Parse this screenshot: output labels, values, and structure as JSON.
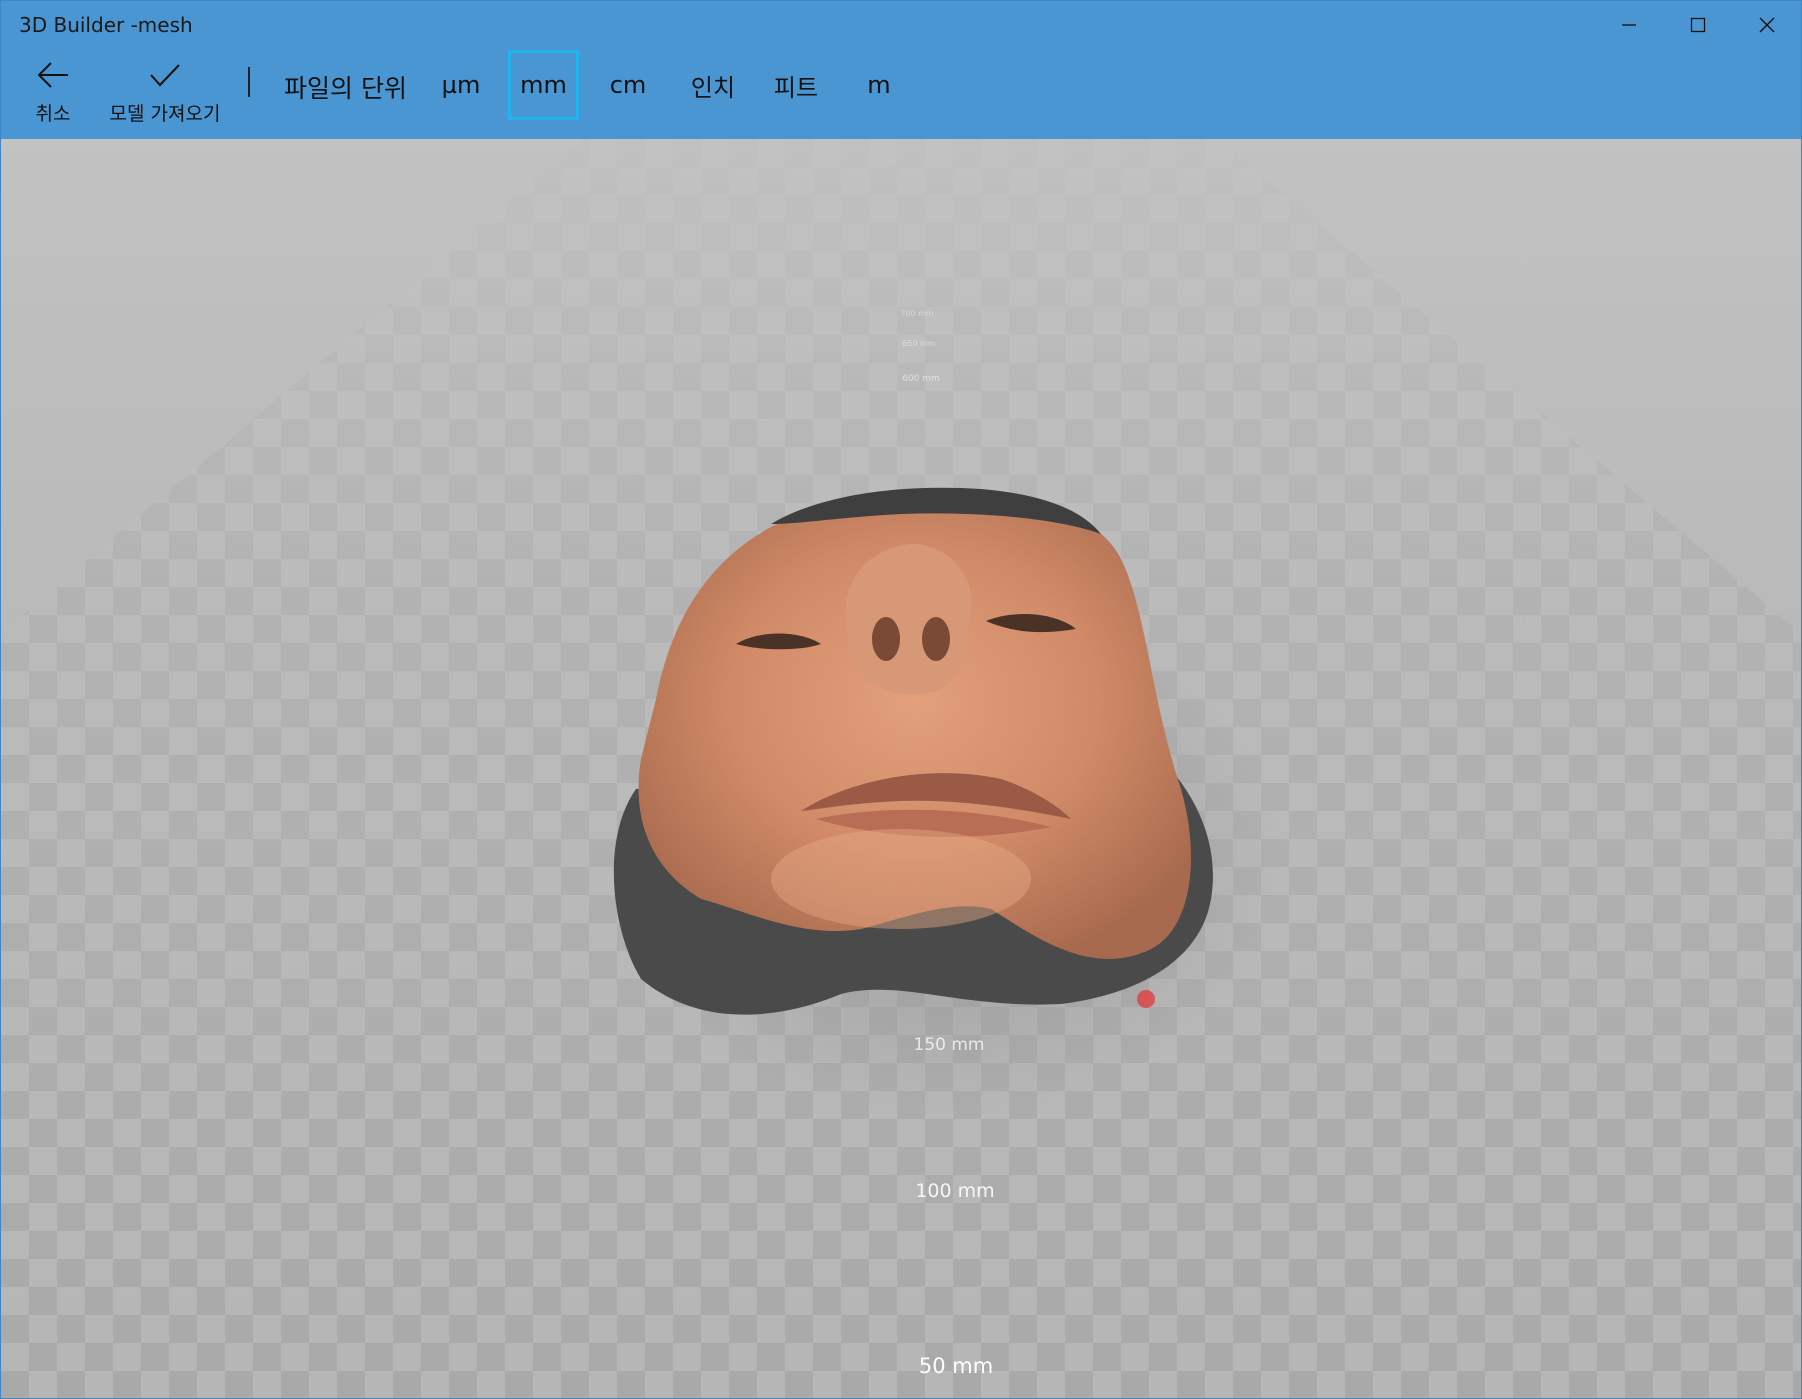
{
  "window": {
    "title": "3D Builder -mesh"
  },
  "toolbar": {
    "cancel_label": "취소",
    "import_label": "모델 가져오기",
    "units_label": "파일의 단위",
    "units": [
      {
        "label": "µm",
        "selected": false
      },
      {
        "label": "mm",
        "selected": true
      },
      {
        "label": "cm",
        "selected": false
      },
      {
        "label": "인치",
        "selected": false
      },
      {
        "label": "피트",
        "selected": false
      },
      {
        "label": "m",
        "selected": false
      }
    ]
  },
  "viewport": {
    "ruler_labels": {
      "r600": "600 mm",
      "r650": "650 mm",
      "r700": "700 mm",
      "r150": "150 mm",
      "r100": "100 mm",
      "r50": "50 mm"
    },
    "model_name": "3D face scan mesh"
  },
  "colors": {
    "titlebar": "#4a96d2",
    "selection_border": "#21b5f0"
  },
  "icons": {
    "cancel": "arrow-left-icon",
    "import": "checkmark-icon",
    "minimize": "minimize-icon",
    "maximize": "maximize-icon",
    "close": "close-icon"
  }
}
